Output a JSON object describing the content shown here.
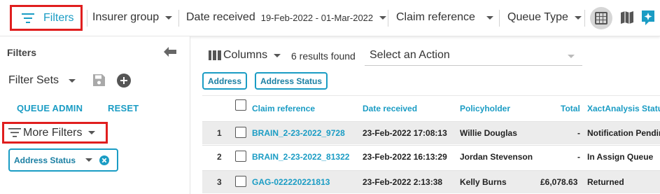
{
  "topbar": {
    "filters_label": "Filters",
    "insurer_group": "Insurer group",
    "date_received_label": "Date received",
    "date_range": "19-Feb-2022 - 01-Mar-2022",
    "claim_reference": "Claim reference",
    "queue_type": "Queue Type",
    "icons": [
      "filter-icon",
      "grid-view-icon",
      "map-icon",
      "ai-assistant-icon"
    ]
  },
  "left": {
    "title": "Filters",
    "filter_sets": "Filter Sets",
    "queue_admin": "QUEUE ADMIN",
    "reset": "RESET",
    "more_filters": "More Filters",
    "address_status_chip": "Address Status"
  },
  "main": {
    "columns_label": "Columns",
    "results_text": "6 results found",
    "action_placeholder": "Select an Action",
    "tags": [
      "Address",
      "Address Status"
    ]
  },
  "table": {
    "headers": {
      "claim_reference": "Claim reference",
      "date_received": "Date received",
      "policyholder": "Policyholder",
      "total": "Total",
      "xact_status": "XactAnalysis Status"
    },
    "rows": [
      {
        "num": "1",
        "claim": "BRAIN_2-23-2022_9728",
        "date": "23-Feb-2022 17:08:13",
        "holder": "Willie Douglas",
        "total": "-",
        "status": "Notification Pending"
      },
      {
        "num": "2",
        "claim": "BRAIN_2-23-2022_81322",
        "date": "23-Feb-2022 16:13:29",
        "holder": "Jordan Stevenson",
        "total": "-",
        "status": "In Assign Queue"
      },
      {
        "num": "3",
        "claim": "GAG-022220221813",
        "date": "23-Feb-2022 2:13:38",
        "holder": "Kelly Burns",
        "total": "£6,078.63",
        "status": "Returned"
      }
    ]
  },
  "colors": {
    "accent": "#1a9cc4",
    "highlight": "#e01e1e",
    "row_alt": "#ececec"
  }
}
